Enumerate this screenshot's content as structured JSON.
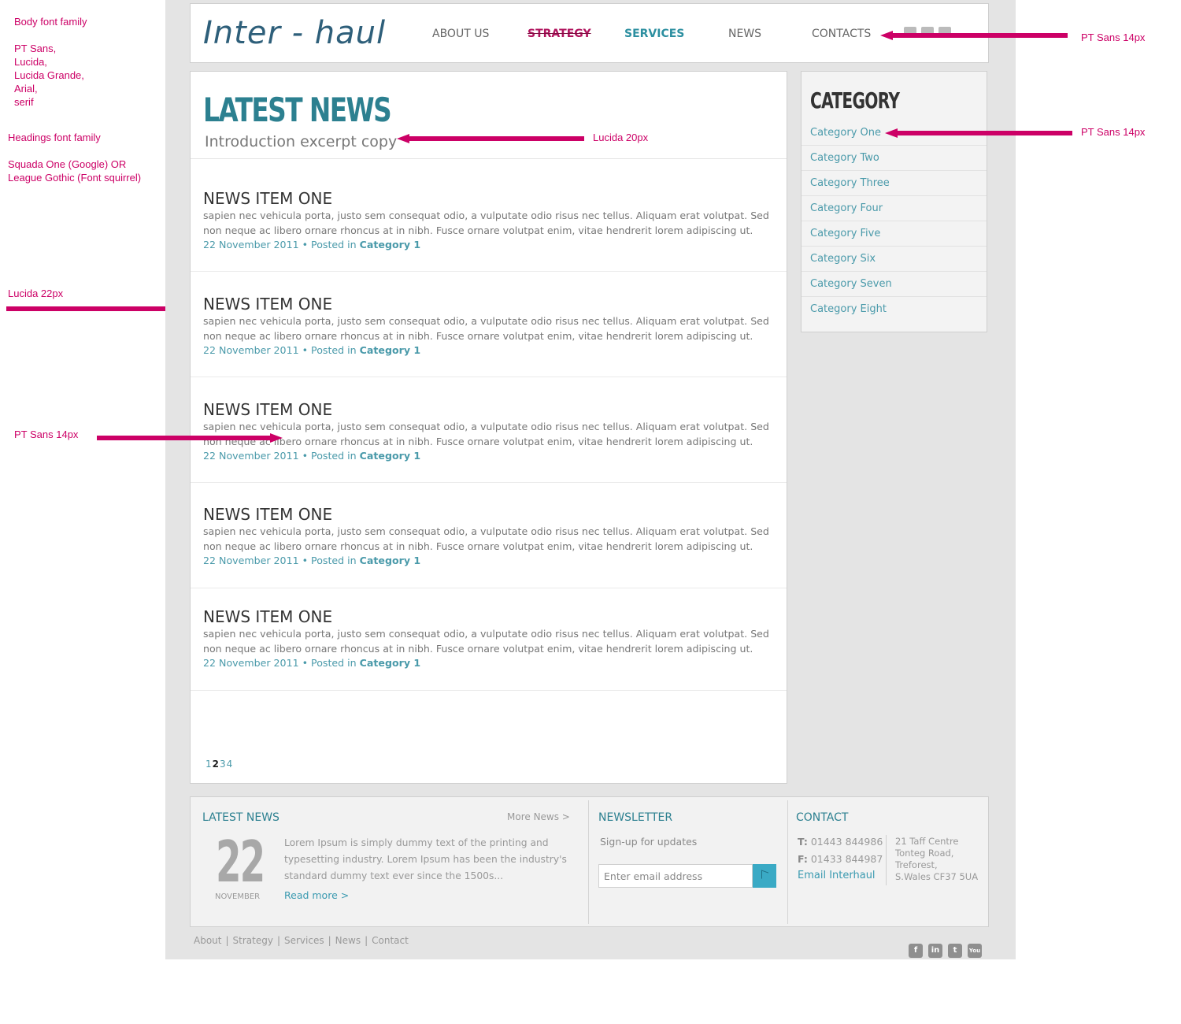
{
  "annotations": {
    "body_font_title": "Body font family",
    "body_font_stack": "PT Sans,\nLucida,\n Lucida Grande,\nArial,\nserif",
    "headings_font_title": "Headings font family",
    "headings_font_stack": "Squada One (Google) OR\nLeague Gothic (Font squirrel)",
    "nav_font": "PT Sans 14px",
    "intro_font": "Lucida 20px",
    "category_font": "PT Sans 14px",
    "news_title_font": "Lucida 22px",
    "news_body_font": "PT Sans 14px",
    "accent_color": "#cc0066"
  },
  "header": {
    "logo": "Inter - haul",
    "nav": [
      "ABOUT US",
      "STRATEGY",
      "SERVICES",
      "NEWS",
      "CONTACTS"
    ]
  },
  "main": {
    "title": "LATEST NEWS",
    "intro": "Introduction excerpt copy",
    "news_items": [
      {
        "title": "NEWS ITEM ONE",
        "body": "sapien nec vehicula porta, justo sem consequat odio, a vulputate odio risus nec tellus. Aliquam erat volutpat. Sed non neque ac libero ornare rhoncus at in nibh. Fusce ornare volutpat enim, vitae hendrerit lorem adipiscing ut.",
        "date": "22 November 2011",
        "posted_in": "• Posted in",
        "category": "Category 1"
      },
      {
        "title": "NEWS ITEM ONE",
        "body": "sapien nec vehicula porta, justo sem consequat odio, a vulputate odio risus nec tellus. Aliquam erat volutpat. Sed non neque ac libero ornare rhoncus at in nibh. Fusce ornare volutpat enim, vitae hendrerit lorem adipiscing ut.",
        "date": "22 November 2011",
        "posted_in": "• Posted in",
        "category": "Category 1"
      },
      {
        "title": "NEWS ITEM ONE",
        "body": "sapien nec vehicula porta, justo sem consequat odio, a vulputate odio risus nec tellus. Aliquam erat volutpat. Sed non neque ac libero ornare rhoncus at in nibh. Fusce ornare volutpat enim, vitae hendrerit lorem adipiscing ut.",
        "date": "22 November 2011",
        "posted_in": "• Posted in",
        "category": "Category 1"
      },
      {
        "title": "NEWS ITEM ONE",
        "body": "sapien nec vehicula porta, justo sem consequat odio, a vulputate odio risus nec tellus. Aliquam erat volutpat. Sed non neque ac libero ornare rhoncus at in nibh. Fusce ornare volutpat enim, vitae hendrerit lorem adipiscing ut.",
        "date": "22 November 2011",
        "posted_in": "• Posted in",
        "category": "Category 1"
      },
      {
        "title": "NEWS ITEM ONE",
        "body": "sapien nec vehicula porta, justo sem consequat odio, a vulputate odio risus nec tellus. Aliquam erat volutpat. Sed non neque ac libero ornare rhoncus at in nibh. Fusce ornare volutpat enim, vitae hendrerit lorem adipiscing ut.",
        "date": "22 November 2011",
        "posted_in": "• Posted in",
        "category": "Category 1"
      }
    ],
    "pagination": {
      "pages": [
        "1",
        "2",
        "3",
        "4"
      ],
      "current": "2"
    }
  },
  "sidebar": {
    "title": "CATEGORY",
    "categories": [
      "Category One",
      "Category Two",
      "Category Three",
      "Category Four",
      "Category Five",
      "Category Six",
      "Category Seven",
      "Category Eight"
    ]
  },
  "footer": {
    "latest_news": {
      "heading": "LATEST NEWS",
      "more_link": "More News >",
      "day": "22",
      "month": "NOVEMBER",
      "excerpt": "Lorem Ipsum is simply dummy text of the printing and typesetting industry. Lorem Ipsum has been the industry's standard dummy text ever since the 1500s...",
      "read_more": "Read more >"
    },
    "newsletter": {
      "heading": "NEWSLETTER",
      "subtitle": "Sign-up for updates",
      "placeholder": "Enter email address"
    },
    "contact": {
      "heading": "CONTACT",
      "phone_label": "T:",
      "phone": "01443 844986",
      "fax_label": "F:",
      "fax": "01433 844987",
      "email_link": "Email Interhaul",
      "address": "21 Taff Centre\nTonteg Road,\nTreforest,\nS.Wales CF37 5UA"
    }
  },
  "bottom_links": [
    "About",
    "Strategy",
    "Services",
    "News",
    "Contact"
  ],
  "social_icons": [
    "facebook-icon",
    "linkedin-icon",
    "twitter-icon",
    "youtube-icon"
  ],
  "social_glyphs": [
    "f",
    "in",
    "t",
    "You"
  ]
}
